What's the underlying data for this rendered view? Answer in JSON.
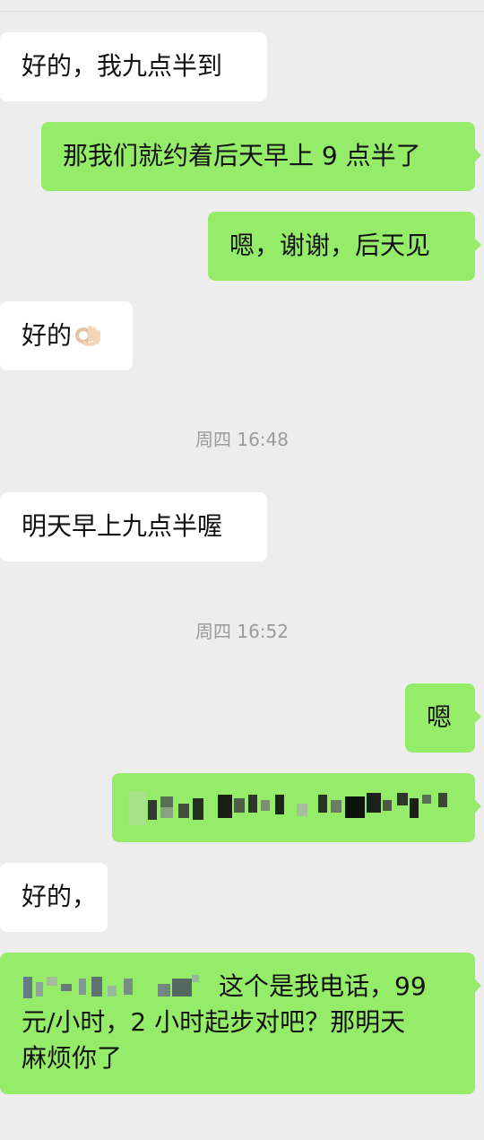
{
  "messages": [
    {
      "side": "incoming",
      "text": "好的，我九点半到"
    },
    {
      "side": "outgoing",
      "text": "那我们就约着后天早上 9 点半了"
    },
    {
      "side": "outgoing",
      "text": "嗯，谢谢，后天见"
    },
    {
      "side": "incoming",
      "text": "好的",
      "emoji": "ok-hand-emoji"
    },
    {
      "side": "incoming",
      "text": "明天早上九点半喔"
    },
    {
      "side": "outgoing",
      "text": "嗯"
    },
    {
      "side": "outgoing",
      "text": "",
      "content": "redacted-pixelated"
    },
    {
      "side": "incoming",
      "text": "好的，"
    },
    {
      "side": "outgoing",
      "lines": [
        "这个是我电话，99",
        "元/小时，2 小时起步对吧？那明天",
        "麻烦你了"
      ],
      "prefix": "redacted-pixelated"
    }
  ],
  "timestamps": [
    "周四 16:48",
    "周四 16:52"
  ],
  "colors": {
    "background": "#ededed",
    "incoming_bubble": "#ffffff",
    "outgoing_bubble": "#95ec69",
    "timestamp_text": "#9b9b9b"
  }
}
